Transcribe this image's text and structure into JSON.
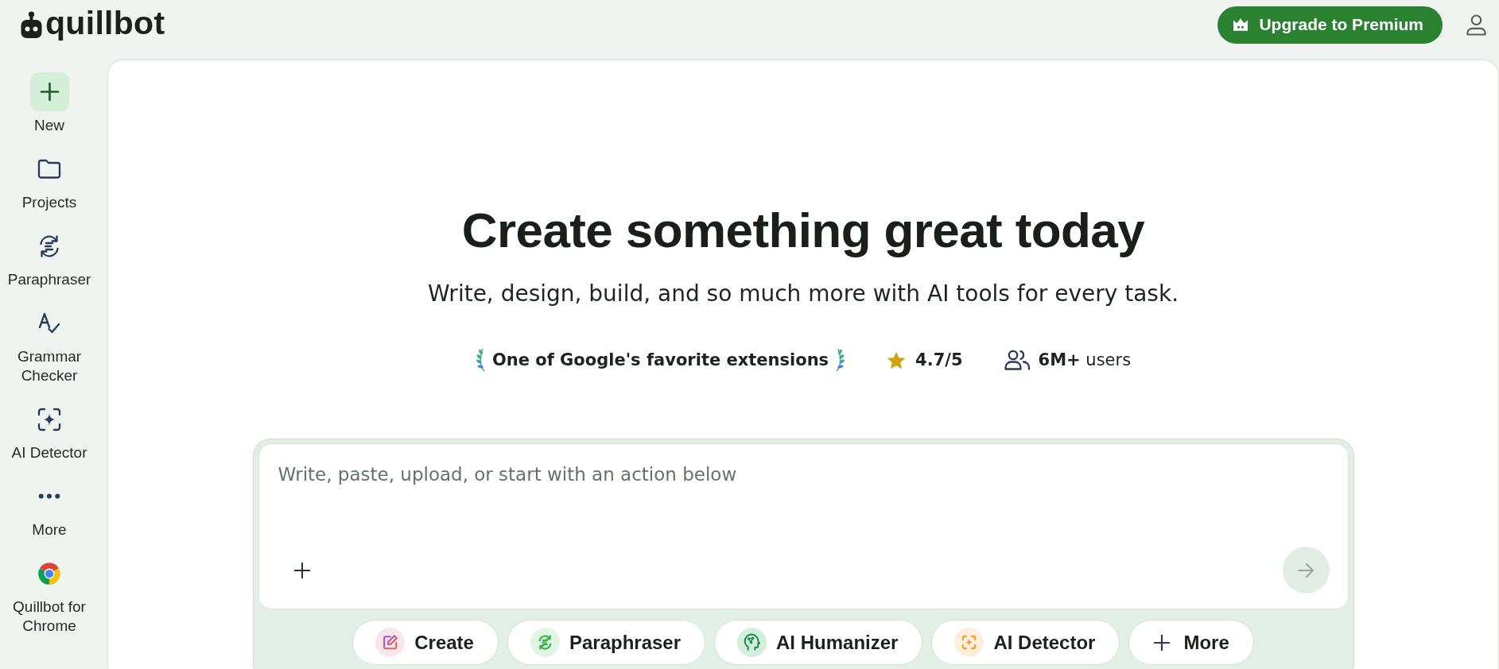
{
  "header": {
    "logo": "quillbot",
    "upgrade_button": {
      "label": "Upgrade to Premium"
    }
  },
  "sidebar": {
    "items": [
      {
        "kind": "new",
        "label": "New"
      },
      {
        "kind": "nav",
        "label": "Projects"
      },
      {
        "kind": "nav",
        "label": "Paraphraser"
      },
      {
        "kind": "nav",
        "label": "Grammar Checker"
      },
      {
        "kind": "nav",
        "label": "AI Detector"
      },
      {
        "kind": "nav",
        "label": "More"
      },
      {
        "kind": "nav",
        "label": "Quillbot for Chrome"
      }
    ]
  },
  "hero": {
    "title": "Create something great today",
    "subtitle": "Write, design, build, and so much more with AI tools for every task."
  },
  "stats": [
    {
      "kind": "award",
      "text": "One of Google's favorite extensions"
    },
    {
      "kind": "rating",
      "text": "4.7/5"
    },
    {
      "kind": "users",
      "text": "**6M+** users"
    }
  ],
  "composer": {
    "placeholder": "Write, paste, upload, or start with an action below",
    "send_button": {
      "disabled": true
    }
  },
  "actions": [
    {
      "kind": "tool",
      "label": "Create"
    },
    {
      "kind": "tool",
      "label": "Paraphraser"
    },
    {
      "kind": "tool",
      "label": "AI Humanizer"
    },
    {
      "kind": "tool",
      "label": "AI Detector"
    },
    {
      "kind": "more",
      "label": "More"
    }
  ]
}
